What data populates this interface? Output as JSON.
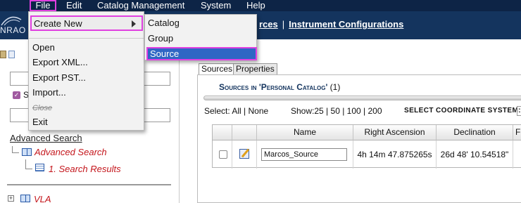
{
  "menubar": {
    "items": [
      "File",
      "Edit",
      "Catalog Management",
      "System",
      "Help"
    ]
  },
  "header": {
    "logo_text": "NRAO",
    "nav_links": [
      "rces",
      "Instrument Configurations"
    ],
    "nav_separator": "|"
  },
  "file_menu": {
    "create_new": "Create New",
    "items": [
      "Open",
      "Export XML...",
      "Export PST...",
      "Import...",
      "Close",
      "Exit"
    ]
  },
  "create_submenu": {
    "items": [
      "Catalog",
      "Group",
      "Source"
    ]
  },
  "sidebar": {
    "checkbox_label": "S",
    "advanced_search_link": "Advanced Search",
    "tree": {
      "advanced_search": "Advanced Search",
      "search_results": "1. Search Results",
      "vla": "VLA"
    }
  },
  "main": {
    "tabs": [
      "Sources",
      "Properties"
    ],
    "panel_title": "Sources in 'Personal Catalog'",
    "panel_count": "(1)",
    "select": {
      "label": "Select:",
      "all": "All",
      "separator": "|",
      "none": "None"
    },
    "show": {
      "label": "Show:",
      "options": [
        "25",
        "50",
        "100",
        "200"
      ]
    },
    "coord_label": "SELECT COORDINATE SYSTEM:",
    "table": {
      "headers": [
        "Name",
        "Right Ascension",
        "Declination",
        "Fl"
      ],
      "rows": [
        {
          "name": "Marcos_Source",
          "ra": "4h 14m 47.875265s",
          "dec": "26d 48' 10.54518\""
        }
      ]
    }
  },
  "colors": {
    "menubar": "#0d2446",
    "header": "#14345e",
    "highlight_border": "#e040e0",
    "selected_item": "#2f66c4",
    "tree_text": "#c4161c"
  }
}
